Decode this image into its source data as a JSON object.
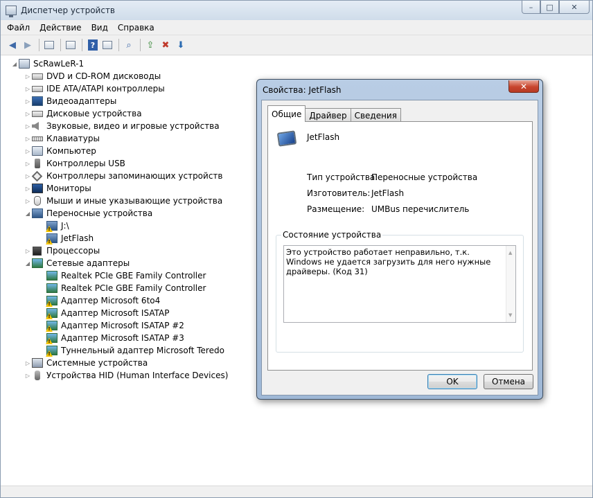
{
  "window": {
    "title": "Диспетчер устройств"
  },
  "caption": {
    "minimize": "–",
    "maximize": "□",
    "close": "✕"
  },
  "menu": [
    "Файл",
    "Действие",
    "Вид",
    "Справка"
  ],
  "toolbar": {
    "icons": [
      "back-icon",
      "forward-icon",
      "console-tree-icon",
      "properties-icon",
      "help-icon",
      "view-icon",
      "scan-hardware-icon",
      "update-driver-icon",
      "disable-device-icon",
      "uninstall-device-icon"
    ]
  },
  "tree": {
    "root": "ScRawLeR-1",
    "categories": [
      {
        "label": "DVD и CD-ROM дисководы",
        "icon": "dvd-drive-icon"
      },
      {
        "label": "IDE ATA/ATAPI контроллеры",
        "icon": "ide-controller-icon"
      },
      {
        "label": "Видеоадаптеры",
        "icon": "display-adapter-icon"
      },
      {
        "label": "Дисковые устройства",
        "icon": "disk-drive-icon"
      },
      {
        "label": "Звуковые, видео и игровые устройства",
        "icon": "speaker-icon"
      },
      {
        "label": "Клавиатуры",
        "icon": "keyboard-icon"
      },
      {
        "label": "Компьютер",
        "icon": "computer-icon"
      },
      {
        "label": "Контроллеры USB",
        "icon": "usb-icon"
      },
      {
        "label": "Контроллеры запоминающих устройств",
        "icon": "storage-controller-icon"
      },
      {
        "label": "Мониторы",
        "icon": "monitor-icon"
      },
      {
        "label": "Мыши и иные указывающие устройства",
        "icon": "mouse-icon"
      },
      {
        "label": "Переносные устройства",
        "icon": "portable-device-icon"
      }
    ],
    "portable_children": [
      "J:\\",
      "JetFlash"
    ],
    "cpu": "Процессоры",
    "network": "Сетевые адаптеры",
    "network_children": [
      {
        "label": "Realtek PCIe GBE Family Controller",
        "warn": false
      },
      {
        "label": "Realtek PCIe GBE Family Controller",
        "warn": false
      },
      {
        "label": "Адаптер Microsoft 6to4",
        "warn": true
      },
      {
        "label": "Адаптер Microsoft ISATAP",
        "warn": true
      },
      {
        "label": "Адаптер Microsoft ISATAP #2",
        "warn": true
      },
      {
        "label": "Адаптер Microsoft ISATAP #3",
        "warn": true
      },
      {
        "label": "Туннельный адаптер Microsoft Teredo",
        "warn": true
      }
    ],
    "system": "Системные устройства",
    "hid": "Устройства HID (Human Interface Devices)"
  },
  "dialog": {
    "title": "Свойства: JetFlash",
    "close": "✕",
    "tabs": [
      "Общие",
      "Драйвер",
      "Сведения"
    ],
    "device_name": "JetFlash",
    "properties": [
      {
        "label": "Тип устройства:",
        "value": "Переносные устройства"
      },
      {
        "label": "Изготовитель:",
        "value": "JetFlash"
      },
      {
        "label": "Размещение:",
        "value": "UMBus перечислитель"
      }
    ],
    "status_group": "Состояние устройства",
    "status_text": "Это устройство работает неправильно, т.к. Windows не удается загрузить для него нужные драйверы. (Код 31)",
    "ok": "OK",
    "cancel": "Отмена"
  }
}
